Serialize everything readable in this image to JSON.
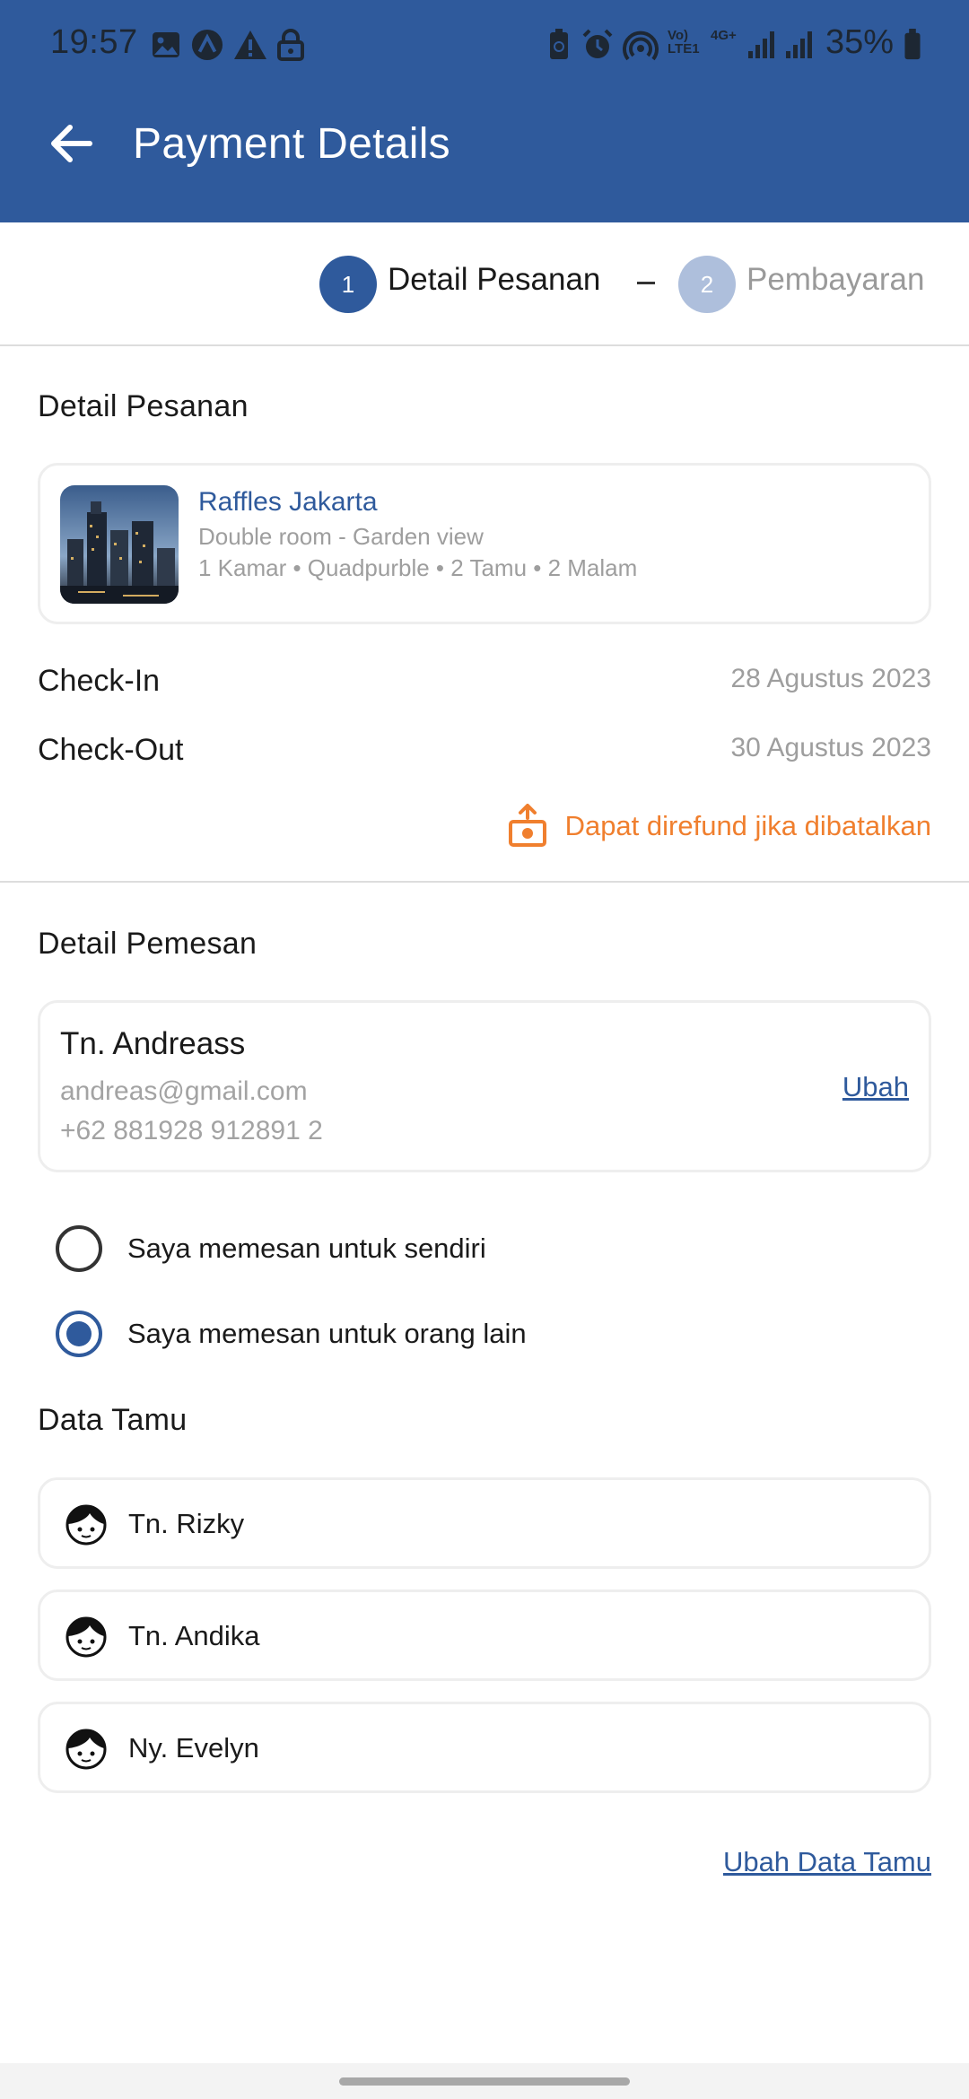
{
  "status_bar": {
    "time": "19:57",
    "battery": "35%",
    "network_labels": [
      "Vo) LTE1",
      "4G+"
    ]
  },
  "app_bar": {
    "title": "Payment Details",
    "back_icon": "arrow-left-icon"
  },
  "stepper": {
    "steps": [
      {
        "number": "1",
        "label": "Detail Pesanan",
        "active": true
      },
      {
        "number": "2",
        "label": "Pembayaran",
        "active": false
      }
    ]
  },
  "order_details": {
    "section_title": "Detail Pesanan",
    "hotel": {
      "name": "Raffles Jakarta",
      "room": "Double room - Garden view",
      "info": "1 Kamar • Quadpurble • 2 Tamu • 2 Malam"
    },
    "check_in": {
      "label": "Check-In",
      "value": "28 Agustus 2023"
    },
    "check_out": {
      "label": "Check-Out",
      "value": "30 Agustus 2023"
    },
    "refund_note": "Dapat direfund jika dibatalkan",
    "refund_icon": "refund-money-icon"
  },
  "orderer": {
    "section_title": "Detail Pemesan",
    "name": "Tn. Andreass",
    "email": "andreas@gmail.com",
    "phone": "+62 881928 912891 2",
    "edit_label": "Ubah"
  },
  "booking_for": {
    "options": [
      {
        "label": "Saya memesan untuk sendiri",
        "selected": false
      },
      {
        "label": "Saya memesan untuk orang lain",
        "selected": true
      }
    ]
  },
  "guests": {
    "section_title": "Data Tamu",
    "items": [
      {
        "name": "Tn. Rizky"
      },
      {
        "name": "Tn. Andika"
      },
      {
        "name": "Ny. Evelyn"
      }
    ],
    "edit_label": "Ubah Data Tamu"
  },
  "colors": {
    "primary": "#2f5a9c",
    "step_inactive": "#aebfdc",
    "refund_orange": "#f07f2e",
    "muted_text": "#9e9e9e"
  }
}
